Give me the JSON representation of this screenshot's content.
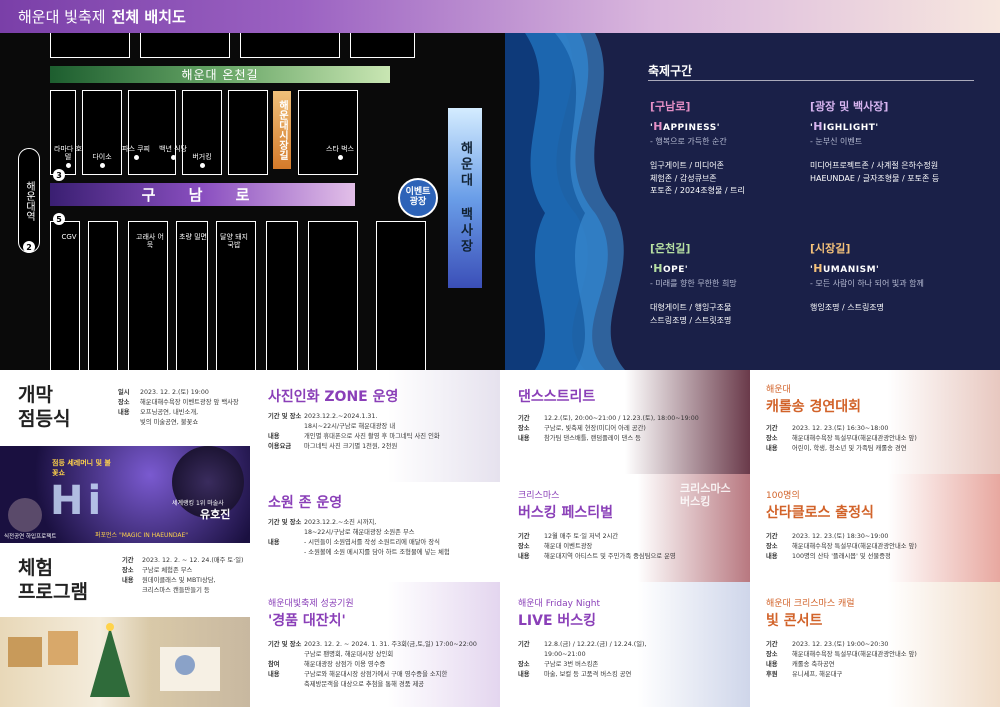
{
  "header": {
    "title": "해운대 빛축제",
    "title_bold": "전체 배치도"
  },
  "map": {
    "road_oncheon": "해운대 온천길",
    "road_guname": "구 남 로",
    "road_sijang": "해운대시장길",
    "road_beachsquare": "해운대 백사장",
    "event_square": "이벤트 광장",
    "station": "해운대역",
    "exits": [
      "3",
      "5",
      "2"
    ],
    "pois": {
      "lamada": "라마다 호텔",
      "daiso": "다이소",
      "paris": "파스 쿠찌",
      "baeknyeon": "백년 식당",
      "burger": "버거킹",
      "starbucks": "스타 벅스",
      "cgv": "CGV",
      "gorae": "고래사 어묵",
      "chopyeong": "초량 밀면",
      "dalyang": "달양 돼지국밥"
    }
  },
  "zones": {
    "title": "축제구간",
    "items": [
      {
        "name": "[구남로]",
        "cap": "H",
        "en": "APPINESS",
        "sub": "- 행복으로 가득한 순간",
        "desc": [
          "입구게이트 / 미디어존",
          "체험존 / 감성큐브존",
          "포토존 / 2024조형물 / 트리"
        ]
      },
      {
        "name": "[광장 및 백사장]",
        "cap": "H",
        "en": "IGHLIGHT",
        "sub": "- 눈부신 이벤트",
        "desc": [
          "미디어프로젝트존 / 사계절 은하수정원",
          "HAEUNDAE / 글자조형물 / 포토존 등"
        ]
      },
      {
        "name": "[온천길]",
        "cap": "H",
        "en": "OPE",
        "sub": "- 미래를 향한 무한한 희망",
        "desc": [
          "대형게이트 / 행잉구조물",
          "스트링조명 / 스트릿조명"
        ]
      },
      {
        "name": "[시장길]",
        "cap": "H",
        "en": "UMANISM",
        "sub": "- 모든 사람이 하나 되어 빛과 함께",
        "desc": [
          "행잉조명 / 스트링조명"
        ]
      }
    ]
  },
  "opening": {
    "title1": "개막",
    "title2": "점등식",
    "rows": [
      [
        "일시",
        "2023. 12. 2.(토) 19:00"
      ],
      [
        "장소",
        "해운대해수욕장 이벤트광장 앞 백사장"
      ],
      [
        "내용",
        "오프닝공연, 내빈소개,"
      ],
      [
        "",
        "빛의 미술공연, 불꽃쇼"
      ]
    ],
    "img_caption1": "점등 세레머니 및 불꽃쇼",
    "img_caption2": "세계랭킹 1위 마술사",
    "img_name": "유호진",
    "img_caption3": "퍼포먼스 \"MAGIC IN HAEUNDAE\"",
    "img_caption4": "식전공연 하입프로젝트"
  },
  "experience": {
    "title1": "체험",
    "title2": "프로그램",
    "rows": [
      [
        "기간",
        "2023. 12. 2. ~ 12. 24.(매주 토·일)"
      ],
      [
        "장소",
        "구남로 체험존 부스"
      ],
      [
        "내용",
        "원데이클래스 및 MBTI상담,"
      ],
      [
        "",
        "크리스마스 캔들만들기 등"
      ]
    ]
  },
  "photo": {
    "title": "사진인화 ZONE 운영",
    "rows": [
      [
        "기간 및 장소",
        "2023.12.2.~2024.1.31."
      ],
      [
        "",
        "18시~22시/구남로 해운대광장 내"
      ],
      [
        "내용",
        "개인별 휴대폰으로 사진 촬영 후 마그네틱 사진 인화"
      ],
      [
        "이용요금",
        "마그네틱 사진 크기별 1천원, 2천원"
      ]
    ]
  },
  "wish": {
    "title": "소원 존 운영",
    "rows": [
      [
        "기간 및 장소",
        "2023.12.2.~소진 시까지,"
      ],
      [
        "",
        "18~22시/구남로 해운대광장 소원존 부스"
      ],
      [
        "내용",
        "- 시민들이 소원엽서를 작성 소원트리에 매달아 장식"
      ],
      [
        "",
        "- 소원볼에 소원 메시지를 담아 하트 조형물에 넣는 체험"
      ]
    ]
  },
  "lottery": {
    "sub": "해운대빛축제 성공기원",
    "title": "'경품 대잔치'",
    "rows": [
      [
        "기간 및 장소",
        "2023. 12. 2. ~ 2024. 1. 31. 주3회(금,토,일) 17:00~22:00"
      ],
      [
        "",
        "구남로 팬명회, 해운대시장 상인회"
      ],
      [
        "참여",
        "해운대광장 상점가 이용 영수증"
      ],
      [
        "내용",
        "구남로와 해운대시장 상점가에서 구매 영수증을 소지한"
      ],
      [
        "",
        "축제방문객을 대상으로 추첨을 통해 경품 제공"
      ]
    ]
  },
  "dance": {
    "title": "댄스스트리트",
    "rows": [
      [
        "기간",
        "12.2.(토), 20:00~21:00 / 12.23.(토), 18:00~19:00"
      ],
      [
        "장소",
        "구남로, 빛축제 현장(미디어 아레 공간)"
      ],
      [
        "내용",
        "참가팀 댄스배틀, 랜덤플레이 댄스 등"
      ]
    ]
  },
  "busking": {
    "sub": "크리스마스",
    "title": "버스킹 페스티벌",
    "img_text": "크리스마스 버스킹",
    "rows": [
      [
        "기간",
        "12월 매주 토·일 저녁 2시간"
      ],
      [
        "장소",
        "해운대 이벤트광장"
      ],
      [
        "내용",
        "해운대지역 아티스트 및 주민가족 중심팀으로 운영"
      ]
    ]
  },
  "live": {
    "sub": "해운대 Friday Night",
    "title": "LIVE 버스킹",
    "rows": [
      [
        "기간",
        "12.8.(금) / 12.22.(금) / 12.24.(일),"
      ],
      [
        "",
        "19:00~21:00"
      ],
      [
        "장소",
        "구남로 3번 버스킹존"
      ],
      [
        "내용",
        "마술, 보컬 등 고품격 버스킹 공연"
      ]
    ]
  },
  "carol": {
    "sub": "해운대",
    "title": "캐롤송 경연대회",
    "rows": [
      [
        "기간",
        "2023. 12. 23.(토) 16:30~18:00"
      ],
      [
        "장소",
        "해운대해수욕장 특설무대(해운대관광안내소 앞)"
      ],
      [
        "내용",
        "어린이, 학생, 청소년 및 가족팀 캐롤송 경연"
      ]
    ]
  },
  "santa": {
    "sub": "100명의",
    "title": "산타클로스 출정식",
    "rows": [
      [
        "기간",
        "2023. 12. 23.(토) 18:30~19:00"
      ],
      [
        "장소",
        "해운대해수욕장 특설무대(해운대관광안내소 앞)"
      ],
      [
        "내용",
        "100명의 산타 '플래시몹' 및 선물증정"
      ]
    ]
  },
  "concert": {
    "sub": "해운대 크리스마스 캐럴",
    "title": "빛 콘서트",
    "rows": [
      [
        "기간",
        "2023. 12. 23.(토) 19:00~20:30"
      ],
      [
        "장소",
        "해운대해수욕장 특설무대(해운대관광안내소 앞)"
      ],
      [
        "내용",
        "캐롤송 축하공연"
      ],
      [
        "후원",
        "유니세프, 해운대구"
      ]
    ]
  },
  "colors": {
    "purple": "#8a3fb8",
    "navy": "#1a2048",
    "orange": "#d2632a",
    "pink": "#e58fc6"
  }
}
